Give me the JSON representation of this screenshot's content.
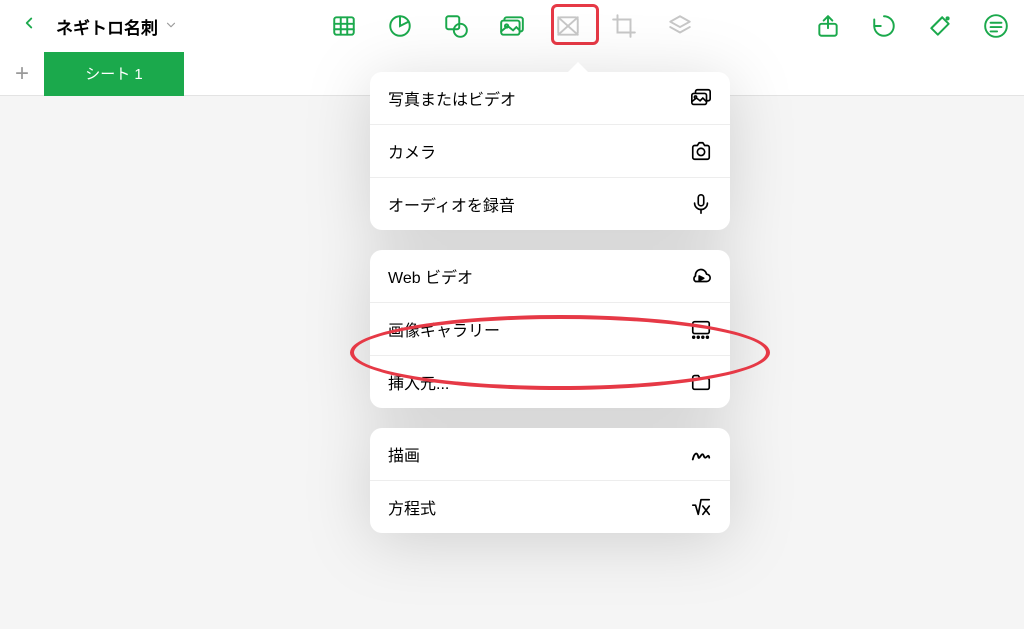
{
  "toolbar": {
    "doc_title": "ネギトロ名刺",
    "icons": {
      "back": "back-chevron",
      "table": "table-icon",
      "chart": "chart-icon",
      "shape": "shape-icon",
      "media": "media-icon",
      "collab": "collab-icon",
      "crop": "crop-icon",
      "layers": "layers-icon",
      "share": "share-icon",
      "undo": "undo-icon",
      "wand": "wand-icon",
      "format": "format-icon"
    }
  },
  "tabs": {
    "add": "+",
    "items": [
      {
        "label": "シート 1"
      }
    ]
  },
  "popover": {
    "groups": [
      {
        "items": [
          {
            "label": "写真またはビデオ",
            "icon": "photo-video-icon"
          },
          {
            "label": "カメラ",
            "icon": "camera-icon"
          },
          {
            "label": "オーディオを録音",
            "icon": "microphone-icon"
          }
        ]
      },
      {
        "items": [
          {
            "label": "Web ビデオ",
            "icon": "cloud-icon"
          },
          {
            "label": "画像ギャラリー",
            "icon": "gallery-icon"
          },
          {
            "label": "挿入元...",
            "icon": "folder-icon"
          }
        ]
      },
      {
        "items": [
          {
            "label": "描画",
            "icon": "scribble-icon"
          },
          {
            "label": "方程式",
            "icon": "equation-icon"
          }
        ]
      }
    ]
  },
  "highlights": {
    "toolbar_media": true,
    "insert_from": true
  }
}
